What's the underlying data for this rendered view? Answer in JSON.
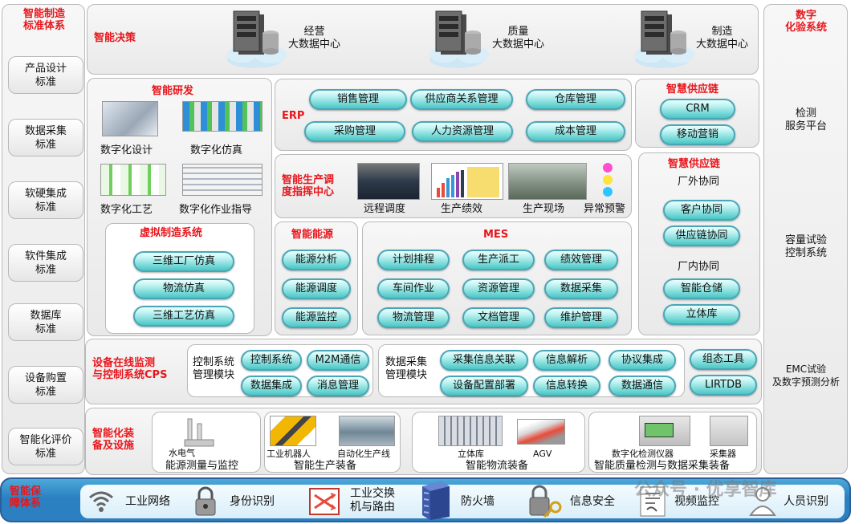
{
  "left_column": {
    "title_line1": "智能制造",
    "title_line2": "标准体系",
    "items": [
      {
        "l1": "产品设计",
        "l2": "标准"
      },
      {
        "l1": "数据采集",
        "l2": "标准"
      },
      {
        "l1": "软硬集成",
        "l2": "标准"
      },
      {
        "l1": "软件集成",
        "l2": "标准"
      },
      {
        "l1": "数据库",
        "l2": "标准"
      },
      {
        "l1": "设备购置",
        "l2": "标准"
      },
      {
        "l1": "智能化评价",
        "l2": "标准"
      }
    ]
  },
  "decision": {
    "title": "智能决策",
    "centers": [
      {
        "l1": "经营",
        "l2": "大数据中心"
      },
      {
        "l1": "质量",
        "l2": "大数据中心"
      },
      {
        "l1": "制造",
        "l2": "大数据中心"
      }
    ]
  },
  "rd": {
    "title": "智能研发",
    "items": [
      "数字化设计",
      "数字化仿真",
      "数字化工艺",
      "数字化作业指导"
    ]
  },
  "virtual": {
    "title": "虚拟制造系统",
    "buttons": [
      "三维工厂仿真",
      "物流仿真",
      "三维工艺仿真"
    ]
  },
  "erp": {
    "title": "ERP",
    "buttons": [
      "销售管理",
      "供应商关系管理",
      "仓库管理",
      "采购管理",
      "人力资源管理",
      "成本管理"
    ]
  },
  "supply_top": {
    "title": "智慧供应链",
    "buttons": [
      "CRM",
      "移动营销"
    ]
  },
  "dispatch": {
    "title_line1": "智能生产调",
    "title_line2": "度指挥中心",
    "items": [
      "远程调度",
      "生产绩效",
      "生产现场",
      "异常预警"
    ]
  },
  "supply_right": {
    "title": "智慧供应链",
    "outer_title": "厂外协同",
    "outer_buttons": [
      "客户协同",
      "供应链协同"
    ],
    "inner_title": "厂内协同",
    "inner_buttons": [
      "智能仓储",
      "立体库"
    ]
  },
  "energy": {
    "title": "智能能源",
    "buttons": [
      "能源分析",
      "能源调度",
      "能源监控"
    ]
  },
  "mes": {
    "title": "MES",
    "buttons": [
      "计划排程",
      "生产派工",
      "绩效管理",
      "车间作业",
      "资源管理",
      "数据采集",
      "物流管理",
      "文档管理",
      "维护管理"
    ]
  },
  "cps": {
    "title_line1": "设备在线监测",
    "title_line2": "与控制系统CPS",
    "ctrl_label_l1": "控制系统",
    "ctrl_label_l2": "管理模块",
    "ctrl_buttons": [
      "控制系统",
      "M2M通信",
      "数据集成",
      "消息管理"
    ],
    "data_label_l1": "数据采集",
    "data_label_l2": "管理模块",
    "data_buttons": [
      "采集信息关联",
      "信息解析",
      "协议集成",
      "设备配置部署",
      "信息转换",
      "数据通信"
    ],
    "tool_buttons": [
      "组态工具",
      "LIRTDB"
    ]
  },
  "equipment": {
    "title_line1": "智能化装",
    "title_line2": "备及设施",
    "groups": [
      {
        "title": "能源测量与监控",
        "items": [
          "水电气"
        ]
      },
      {
        "title": "智能生产装备",
        "items": [
          "工业机器人",
          "自动化生产线"
        ]
      },
      {
        "title": "智能物流装备",
        "items": [
          "立体库",
          "AGV"
        ]
      },
      {
        "title": "智能质量检测与数据采集装备",
        "items": [
          "数字化检测仪器",
          "采集器"
        ]
      }
    ]
  },
  "right_column": {
    "title_line1": "数字",
    "title_line2": "化验系统",
    "items": [
      {
        "l1": "检测",
        "l2": "服务平台"
      },
      {
        "l1": "容量试验",
        "l2": "控制系统"
      },
      {
        "l1": "EMC试验",
        "l2": "及数字预测分析"
      }
    ]
  },
  "guarantee": {
    "title_line1": "智能保",
    "title_line2": "障体系",
    "items": [
      {
        "label": "工业网络",
        "icon": "wifi-icon"
      },
      {
        "label": "身份识别",
        "icon": "lock-icon"
      },
      {
        "label_l1": "工业交换",
        "label_l2": "机与路由",
        "icon": "switch-icon"
      },
      {
        "label": "防火墙",
        "icon": "firewall-icon"
      },
      {
        "label": "信息安全",
        "icon": "key-lock-icon"
      },
      {
        "label": "视频监控",
        "icon": "document-icon"
      },
      {
        "label": "人员识别",
        "icon": "person-icon"
      }
    ]
  },
  "watermark": "公众号 · 优享智库",
  "colors": {
    "title_red": "#e8161c",
    "pill_border": "#4aa6b6",
    "bar_blue": "#2c7fc0"
  }
}
